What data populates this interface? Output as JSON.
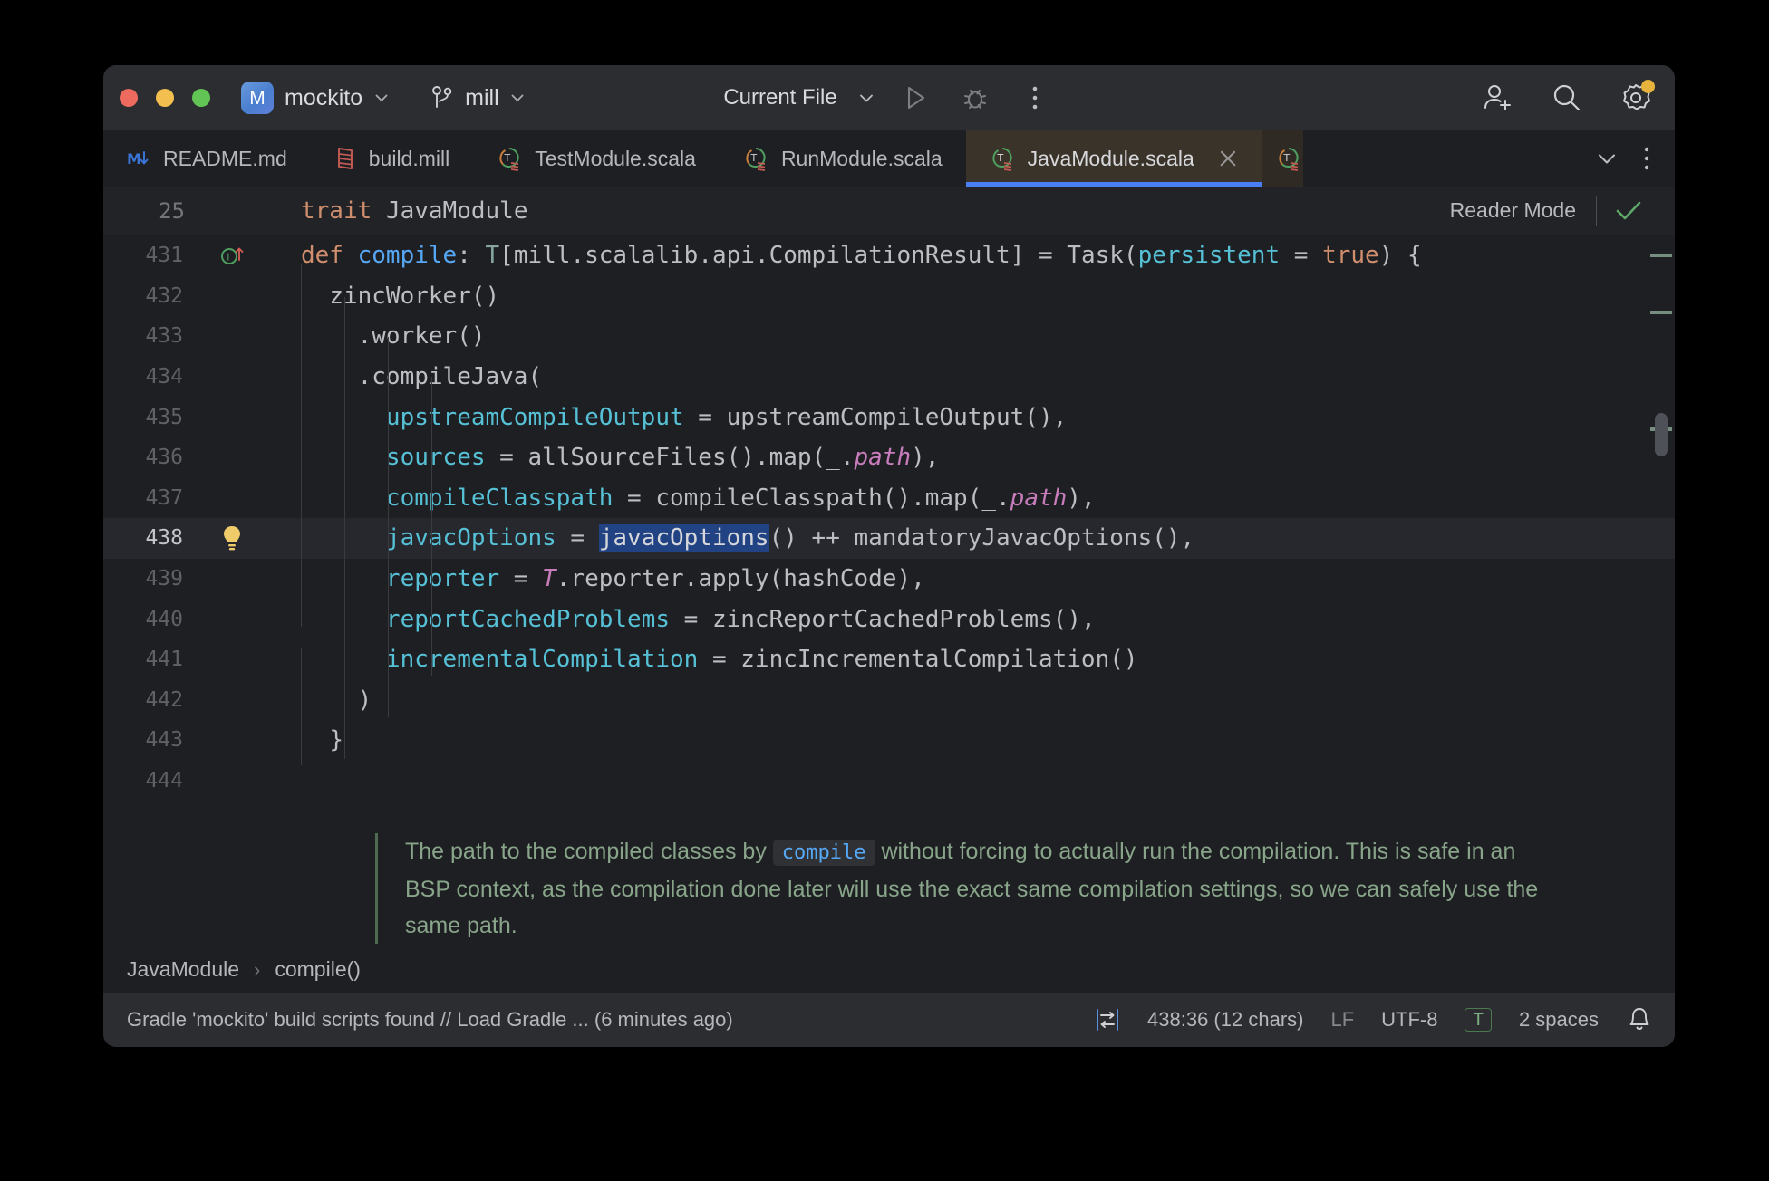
{
  "titlebar": {
    "project_badge": "M",
    "project_name": "mockito",
    "branch_name": "mill",
    "run_config": "Current File",
    "icons": {
      "run": "run-icon",
      "debug": "debug-icon",
      "more": "more-vertical-icon",
      "add_user": "add-user-icon",
      "search": "search-icon",
      "settings": "settings-gear-icon"
    }
  },
  "tabs": [
    {
      "label": "README.md",
      "icon": "markdown-icon",
      "active": false
    },
    {
      "label": "build.mill",
      "icon": "mill-file-icon",
      "active": false
    },
    {
      "label": "TestModule.scala",
      "icon": "scala-trait-icon",
      "active": false
    },
    {
      "label": "RunModule.scala",
      "icon": "scala-trait-icon",
      "active": false
    },
    {
      "label": "JavaModule.scala",
      "icon": "scala-trait-icon",
      "active": true
    }
  ],
  "tabbar_actions": {
    "chevron": "chevron-down-icon",
    "more": "more-vertical-icon"
  },
  "sticky_header": {
    "line_number": "25",
    "keyword": "trait",
    "name": "JavaModule",
    "reader_mode_label": "Reader Mode",
    "reader_mode_checked": true
  },
  "editor": {
    "lines": [
      {
        "n": "431",
        "gutter": "override-implement-icon"
      },
      {
        "n": "432",
        "gutter": ""
      },
      {
        "n": "433",
        "gutter": ""
      },
      {
        "n": "434",
        "gutter": ""
      },
      {
        "n": "435",
        "gutter": ""
      },
      {
        "n": "436",
        "gutter": ""
      },
      {
        "n": "437",
        "gutter": ""
      },
      {
        "n": "438",
        "gutter": "intention-bulb-icon",
        "current": true
      },
      {
        "n": "439",
        "gutter": ""
      },
      {
        "n": "440",
        "gutter": ""
      },
      {
        "n": "441",
        "gutter": ""
      },
      {
        "n": "442",
        "gutter": ""
      },
      {
        "n": "443",
        "gutter": ""
      },
      {
        "n": "444",
        "gutter": ""
      }
    ],
    "code": {
      "l431_def": "def",
      "l431_name": " compile",
      "l431_colon": ": ",
      "l431_T": "T",
      "l431_type": "[mill.scalalib.api.CompilationResult] = Task(",
      "l431_persistent": "persistent",
      "l431_eq": " = ",
      "l431_true": "true",
      "l431_tail": ") {",
      "l432": "zincWorker()",
      "l433": ".worker()",
      "l434": ".compileJava(",
      "l435_name": "upstreamCompileOutput",
      "l435_rest": " = upstreamCompileOutput(),",
      "l436_name": "sources",
      "l436_a": " = allSourceFiles().map(_.",
      "l436_path": "path",
      "l436_b": "),",
      "l437_name": "compileClasspath",
      "l437_a": " = compileClasspath().map(_.",
      "l437_path": "path",
      "l437_b": "),",
      "l438_name": "javacOptions",
      "l438_eq": " = ",
      "l438_sel": "javacOptions",
      "l438_rest": "() ++ mandatoryJavacOptions(),",
      "l439_name": "reporter",
      "l439_eq": " = ",
      "l439_T": "T",
      "l439_rest": ".reporter.apply(hashCode),",
      "l440_name": "reportCachedProblems",
      "l440_rest": " = zincReportCachedProblems(),",
      "l441_name": "incrementalCompilation",
      "l441_rest": " = zincIncrementalCompilation()",
      "l442": ")",
      "l443": "}"
    },
    "doc_comment": {
      "part1": "The path to the compiled classes by ",
      "code": "compile",
      "part2": " without forcing to actually run the compilation. This is safe in an BSP context, as the compilation done later will use the exact same compilation settings, so we can safely use the same path."
    }
  },
  "breadcrumbs": {
    "items": [
      "JavaModule",
      "compile()"
    ],
    "separator": "›"
  },
  "statusbar": {
    "message": "Gradle 'mockito' build scripts found // Load Gradle ... (6 minutes ago)",
    "wrap_icon": "soft-wrap-icon",
    "position": "438:36 (12 chars)",
    "line_separator": "LF",
    "encoding": "UTF-8",
    "read_only_badge": "T",
    "indent": "2 spaces",
    "notifications_icon": "bell-icon"
  },
  "colors": {
    "accent_blue": "#4a7ef5",
    "selection": "#214283",
    "tab_active_bg": "#3a3329",
    "titlebar_bg": "#2b2d30",
    "editor_bg": "#1e1f22"
  }
}
